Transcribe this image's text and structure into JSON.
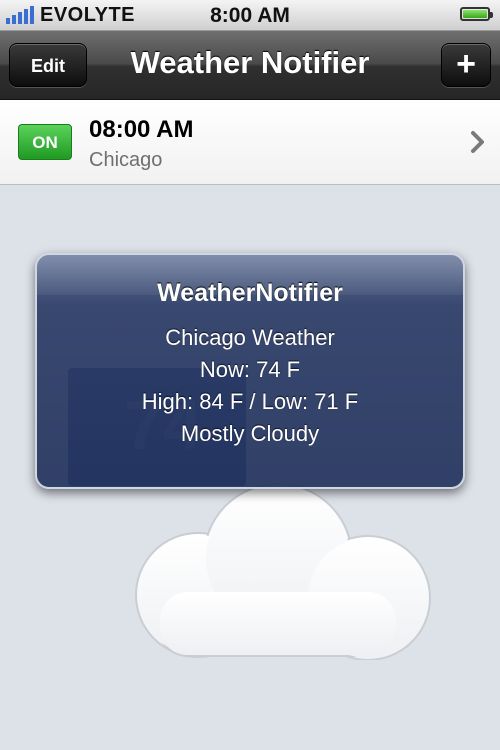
{
  "status_bar": {
    "carrier": "EVOLYTE",
    "time": "8:00 AM",
    "signal_icon": "signal-bars-icon",
    "battery_icon": "battery-icon",
    "battery_level": 1.0
  },
  "nav": {
    "title": "Weather Notifier",
    "edit_label": "Edit",
    "add_label": "+"
  },
  "alarm": {
    "toggle_label": "ON",
    "time": "08:00 AM",
    "city": "Chicago",
    "chevron_icon": "chevron-right-icon"
  },
  "background": {
    "temperature_tile": "74",
    "cloud_icon": "cloud-icon"
  },
  "alert": {
    "title": "WeatherNotifier",
    "lines": [
      "Chicago Weather",
      "Now: 74 F",
      "High: 84 F / Low: 71 F",
      "Mostly Cloudy"
    ]
  },
  "colors": {
    "nav_bar": "#262626",
    "on_badge": "#1f9a22",
    "alert_background": "#22325c",
    "page_background": "#dde1e8"
  }
}
